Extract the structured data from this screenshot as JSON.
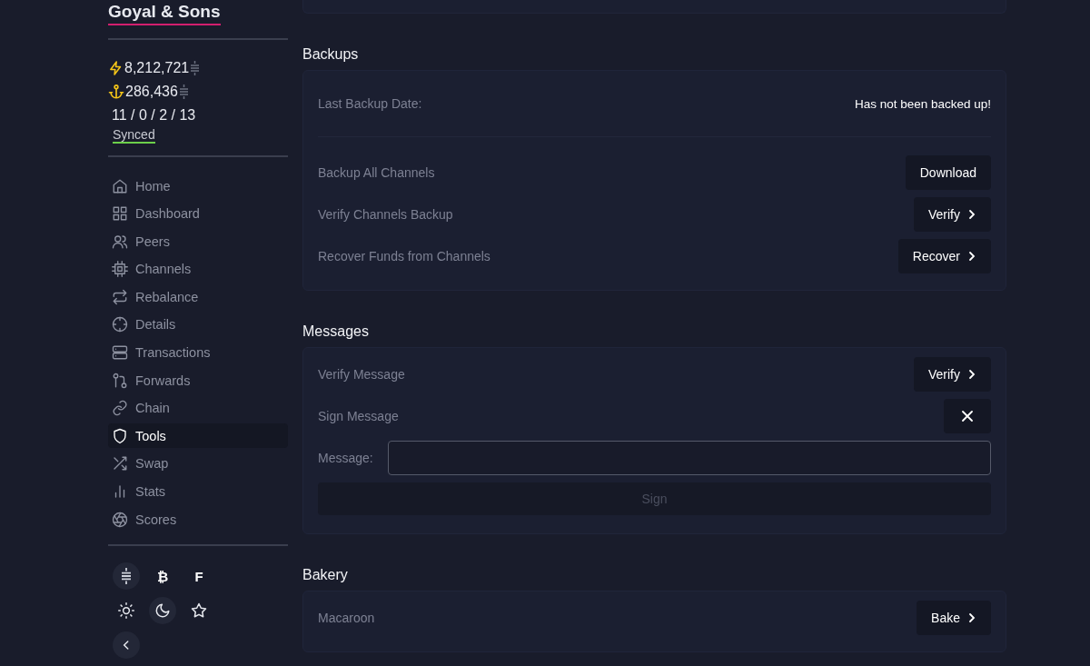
{
  "sidebar": {
    "title": "Goyal & Sons",
    "balances": [
      {
        "kind": "lightning",
        "amount": "8,212,721"
      },
      {
        "kind": "anchor",
        "amount": "286,436"
      }
    ],
    "counts": "11 / 0 / 2 / 13",
    "sync_status": "Synced",
    "nav": [
      {
        "kind": "home",
        "label": "Home",
        "selected": false
      },
      {
        "kind": "grid",
        "label": "Dashboard",
        "selected": false
      },
      {
        "kind": "users",
        "label": "Peers",
        "selected": false
      },
      {
        "kind": "chip",
        "label": "Channels",
        "selected": false
      },
      {
        "kind": "repeat",
        "label": "Rebalance",
        "selected": false
      },
      {
        "kind": "crosshair",
        "label": "Details",
        "selected": false
      },
      {
        "kind": "server",
        "label": "Transactions",
        "selected": false
      },
      {
        "kind": "git",
        "label": "Forwards",
        "selected": false
      },
      {
        "kind": "link",
        "label": "Chain",
        "selected": false
      },
      {
        "kind": "shield",
        "label": "Tools",
        "selected": true
      },
      {
        "kind": "shuffle",
        "label": "Swap",
        "selected": false
      },
      {
        "kind": "bars",
        "label": "Stats",
        "selected": false
      },
      {
        "kind": "aperture",
        "label": "Scores",
        "selected": false
      }
    ],
    "currency_options": [
      {
        "kind": "sats",
        "selected": true
      },
      {
        "kind": "text",
        "label": "₿",
        "selected": false
      },
      {
        "kind": "text",
        "label": "F",
        "selected": false
      }
    ],
    "theme_options": [
      {
        "kind": "sun",
        "selected": false
      },
      {
        "kind": "moon",
        "selected": true
      },
      {
        "kind": "star",
        "selected": false
      }
    ]
  },
  "sections": [
    {
      "title": "Backups",
      "rows": [
        {
          "kind": "info",
          "label": "Last Backup Date:",
          "value": "Has not been backed up!"
        },
        {
          "kind": "action",
          "label": "Backup All Channels",
          "button": "Download",
          "chevron": false
        },
        {
          "kind": "action",
          "label": "Verify Channels Backup",
          "button": "Verify",
          "chevron": true
        },
        {
          "kind": "action",
          "label": "Recover Funds from Channels",
          "button": "Recover",
          "chevron": true
        }
      ]
    },
    {
      "title": "Messages",
      "rows": [
        {
          "kind": "action",
          "label": "Verify Message",
          "button": "Verify",
          "chevron": true
        },
        {
          "kind": "close",
          "label": "Sign Message"
        },
        {
          "kind": "input",
          "label": "Message:"
        },
        {
          "kind": "submit",
          "button": "Sign",
          "disabled": true
        }
      ]
    },
    {
      "title": "Bakery",
      "rows": [
        {
          "kind": "action",
          "label": "Macaroon",
          "button": "Bake",
          "chevron": true
        }
      ]
    }
  ]
}
